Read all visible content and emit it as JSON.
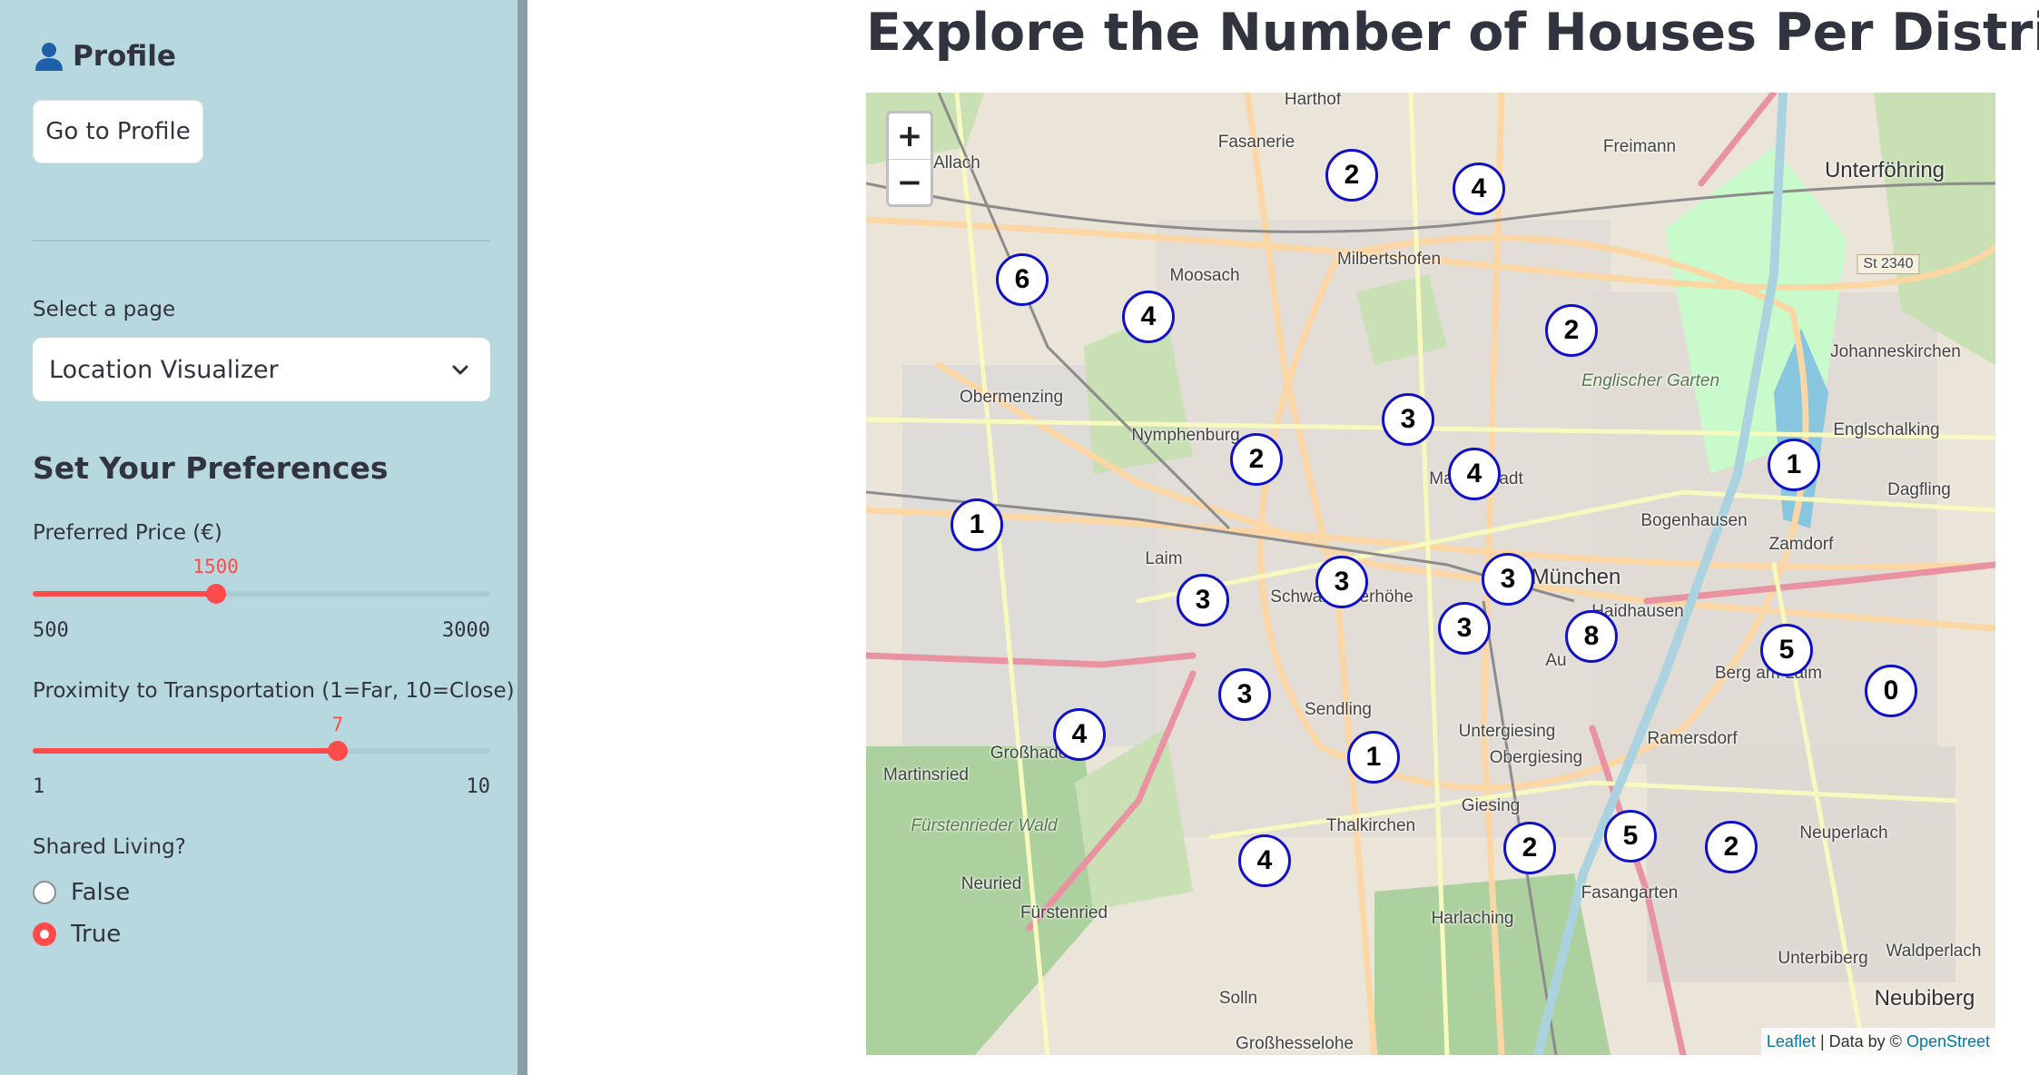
{
  "sidebar": {
    "profile_heading": "Profile",
    "profile_button": "Go to Profile",
    "select_label": "Select a page",
    "select_value": "Location Visualizer",
    "preferences_heading": "Set Your Preferences",
    "price": {
      "label": "Preferred Price (€)",
      "value": 1500,
      "min": 500,
      "max": 3000,
      "value_text": "1500",
      "min_text": "500",
      "max_text": "3000"
    },
    "proximity": {
      "label": "Proximity to Transportation (1=Far, 10=Close)",
      "value": 7,
      "min": 1,
      "max": 10,
      "value_text": "7",
      "min_text": "1",
      "max_text": "10"
    },
    "shared_living": {
      "label": "Shared Living?",
      "options": [
        "False",
        "True"
      ],
      "selected": "True"
    }
  },
  "main": {
    "title": "Explore the Number of Houses Per District"
  },
  "map": {
    "zoom_in": "+",
    "zoom_out": "−",
    "attribution": {
      "leaflet": "Leaflet",
      "separator": " | Data by © ",
      "osm": "OpenStreet"
    },
    "places": [
      "Harthof",
      "Fasanerie",
      "Freimann",
      "Allach",
      "Unterföhring",
      "Milbertshofen",
      "Moosach",
      "Johanneskirchen",
      "Obermenzing",
      "Englschalking",
      "Nymphenburg",
      "Maxvorstadt",
      "Dagfling",
      "Bogenhausen",
      "Zamdorf",
      "Laim",
      "Schwanthalerhöhe",
      "München",
      "Haidhausen",
      "Au",
      "Berg am Laim",
      "Sendling",
      "Untergiesing",
      "Obergiesing",
      "Ramersdorf",
      "Martinsried",
      "Großhadern",
      "Giesing",
      "Thalkirchen",
      "Neuperlach",
      "Neuried",
      "Fürstenried",
      "Fasangarten",
      "Harlaching",
      "Unterbiberg",
      "Waldperlach",
      "Solln",
      "Neubiberg",
      "Großhesselohe",
      "Fürstenrieder Wald",
      "Englischer Garten",
      "St 2340"
    ],
    "district_counts": [
      "2",
      "4",
      "6",
      "4",
      "2",
      "3",
      "2",
      "4",
      "1",
      "1",
      "3",
      "3",
      "3",
      "3",
      "8",
      "5",
      "0",
      "3",
      "4",
      "1",
      "2",
      "5",
      "2",
      "4"
    ]
  }
}
